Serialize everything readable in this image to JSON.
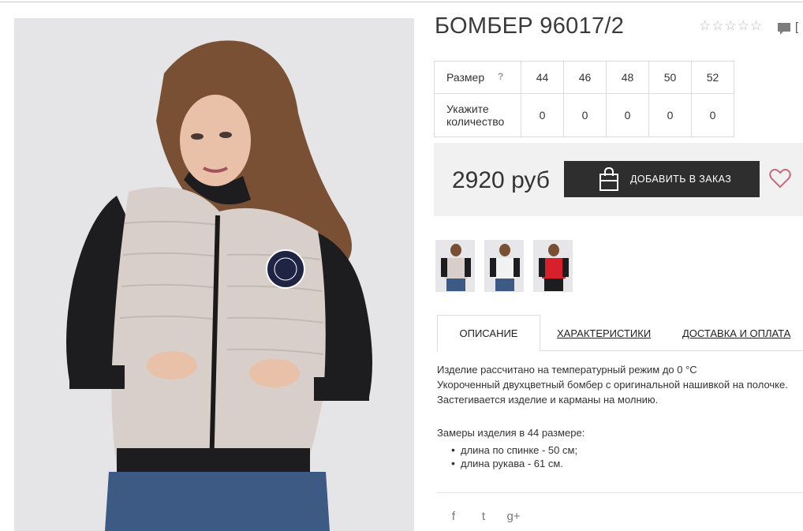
{
  "product": {
    "title": "БОМБЕР 96017/2",
    "rating_stars": [
      "☆",
      "☆",
      "☆",
      "☆",
      "☆"
    ],
    "more_glyph": "["
  },
  "size_table": {
    "size_label": "Размер",
    "help": "?",
    "sizes": [
      "44",
      "46",
      "48",
      "50",
      "52"
    ],
    "qty_label_line1": "Укажите",
    "qty_label_line2": "количество",
    "quantities": [
      "0",
      "0",
      "0",
      "0",
      "0"
    ]
  },
  "buy": {
    "price": "2920 руб",
    "add_button": "ДОБАВИТЬ В ЗАКАЗ"
  },
  "tabs": {
    "description": "ОПИСАНИЕ",
    "characteristics": "ХАРАКТЕРИСТИКИ",
    "delivery": "ДОСТАВКА И ОПЛАТА"
  },
  "description": {
    "line1": "Изделие рассчитано на температурный режим до 0 °С",
    "line2": "Укороченный двухцветный бомбер с оригинальной нашивкой на полочке.",
    "line3": "Застегивается изделие и карманы на молнию.",
    "measure_title": "Замеры изделия в 44 размере:",
    "measures": [
      "длина по спинке - 50 см;",
      "длина рукава - 61 см."
    ]
  },
  "social": {
    "facebook": "f",
    "twitter": "t",
    "google": "g+"
  },
  "colors": {
    "accent_heart": "#c96a7c",
    "button_bg": "#2e2e2e",
    "buy_box_bg": "#f1f1f1"
  }
}
